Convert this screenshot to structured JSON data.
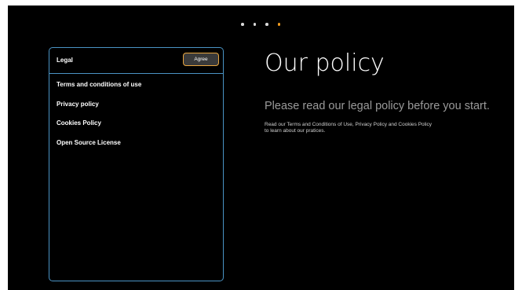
{
  "pager": {
    "count": 4,
    "active_index": 3,
    "dot_color": "#d9d9d9",
    "active_color": "#f29c1f"
  },
  "legal_panel": {
    "title": "Legal",
    "agree_label": "Agree",
    "items": [
      {
        "label": "Terms and conditions of use"
      },
      {
        "label": "Privacy policy"
      },
      {
        "label": "Cookies Policy"
      },
      {
        "label": "Open Source License"
      }
    ]
  },
  "main": {
    "title": "Our policy",
    "subtitle": "Please read our legal policy before you start.",
    "description_line1": "Read our Terms and Conditions of Use, Privacy Policy and Cookies Policy",
    "description_line2": "to learn about our pratices."
  },
  "colors": {
    "background": "#000000",
    "panel_border": "#4a93c4",
    "button_border": "#e8a640"
  }
}
